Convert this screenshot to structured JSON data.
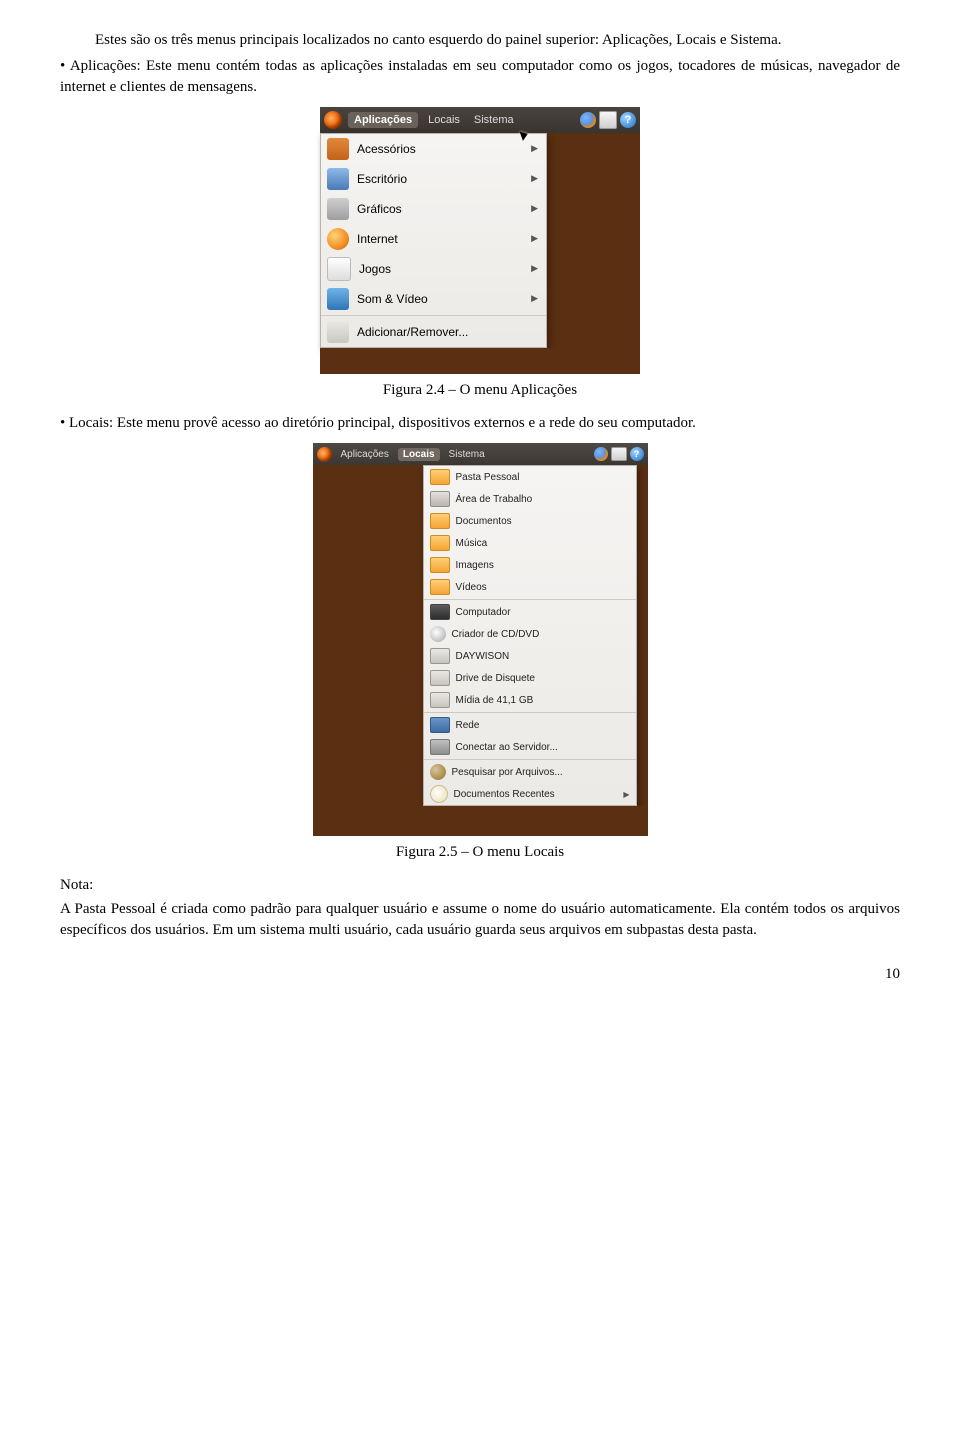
{
  "para1": "Estes são os três menus principais localizados no canto esquerdo do painel superior: Aplicações, Locais e Sistema.",
  "bullet1": "• Aplicações: Este menu contém todas as aplicações instaladas em seu computador como os jogos, tocadores de músicas, navegador de internet e clientes de mensagens.",
  "caption1": "Figura 2.4 – O menu Aplicações",
  "bullet2": "• Locais: Este menu provê acesso ao diretório principal, dispositivos externos e a rede do seu computador.",
  "caption2": "Figura 2.5 – O menu Locais",
  "noteLabel": "Nota:",
  "notePara": "A Pasta Pessoal é criada como padrão para qualquer usuário e assume o nome do usuário automaticamente. Ela contém todos os arquivos específicos dos usuários. Em um sistema multi usuário, cada usuário guarda seus arquivos em subpastas desta pasta.",
  "pageNumber": "10",
  "panel": {
    "aplicacoes": "Aplicações",
    "locais": "Locais",
    "sistema": "Sistema",
    "help": "?"
  },
  "menu1": {
    "acessorios": "Acessórios",
    "escritorio": "Escritório",
    "graficos": "Gráficos",
    "internet": "Internet",
    "jogos": "Jogos",
    "somvideo": "Som & Vídeo",
    "adicionar": "Adicionar/Remover..."
  },
  "menu2": {
    "pasta": "Pasta Pessoal",
    "area": "Área de Trabalho",
    "docs": "Documentos",
    "musica": "Música",
    "imagens": "Imagens",
    "videos": "Vídeos",
    "computador": "Computador",
    "criador": "Criador de CD/DVD",
    "daywison": "DAYWISON",
    "disquete": "Drive de Disquete",
    "midia": "Mídia de 41,1 GB",
    "rede": "Rede",
    "conectar": "Conectar ao Servidor...",
    "pesquisar": "Pesquisar por Arquivos...",
    "recentes": "Documentos Recentes"
  }
}
